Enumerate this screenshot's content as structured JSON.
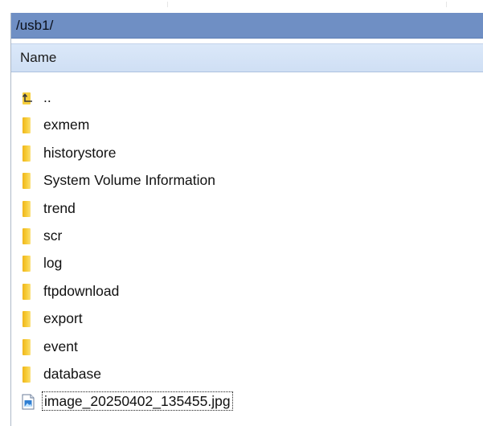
{
  "path_bar": {
    "path": "/usb1/"
  },
  "columns": {
    "name_label": "Name"
  },
  "entries": [
    {
      "name": "..",
      "type": "parent",
      "icon": "parent-folder-icon"
    },
    {
      "name": "exmem",
      "type": "folder",
      "icon": "folder-icon"
    },
    {
      "name": "historystore",
      "type": "folder",
      "icon": "folder-icon"
    },
    {
      "name": "System Volume Information",
      "type": "folder",
      "icon": "folder-icon"
    },
    {
      "name": "trend",
      "type": "folder",
      "icon": "folder-icon"
    },
    {
      "name": "scr",
      "type": "folder",
      "icon": "folder-icon"
    },
    {
      "name": "log",
      "type": "folder",
      "icon": "folder-icon"
    },
    {
      "name": "ftpdownload",
      "type": "folder",
      "icon": "folder-icon"
    },
    {
      "name": "export",
      "type": "folder",
      "icon": "folder-icon"
    },
    {
      "name": "event",
      "type": "folder",
      "icon": "folder-icon"
    },
    {
      "name": "database",
      "type": "folder",
      "icon": "folder-icon"
    },
    {
      "name": "image_20250402_135455.jpg",
      "type": "file",
      "icon": "image-file-icon",
      "selected": true
    }
  ],
  "colors": {
    "path_bar_bg": "#6f8fc4",
    "header_bg": "#d6e4f7",
    "folder": "#f7cf3d"
  }
}
